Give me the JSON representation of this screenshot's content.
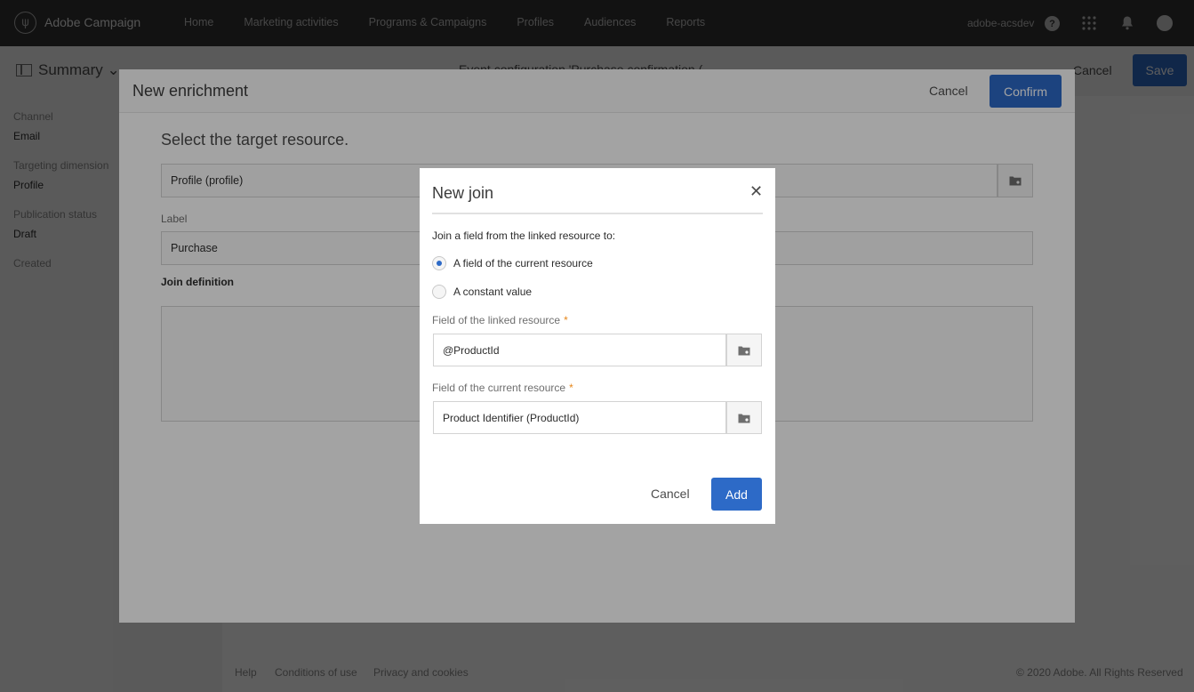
{
  "app": {
    "brand": "Adobe Campaign"
  },
  "nav": {
    "links": [
      "Home",
      "Marketing activities",
      "Programs & Campaigns",
      "Profiles",
      "Audiences",
      "Reports"
    ],
    "account": "adobe-acsdev",
    "help_glyph": "?"
  },
  "page": {
    "summary_label": "Summary",
    "summary_chevron": "⌄",
    "title": "Event configuration 'Purchase confirmation (",
    "cancel_label": "Cancel",
    "save_label": "Save",
    "side": [
      {
        "label": "Channel",
        "value": "Email"
      },
      {
        "label": "Targeting dimension",
        "value": "Profile"
      },
      {
        "label": "Publication status",
        "value": "Draft"
      },
      {
        "label": "Created",
        "value": ""
      }
    ],
    "footer": {
      "links": [
        "Help",
        "Conditions of use",
        "Privacy and cookies"
      ],
      "copyright": "© 2020 Adobe. All Rights Reserved"
    }
  },
  "enrichment": {
    "title": "New enrichment",
    "cancel_label": "Cancel",
    "confirm_label": "Confirm",
    "heading": "Select the target resource.",
    "target_value": "Profile (profile)",
    "label_caption": "Label",
    "label_value": "Purchase",
    "join_definition": "Join definition"
  },
  "join_modal": {
    "title": "New join",
    "close_glyph": "✕",
    "intro": "Join a field from the linked resource to:",
    "options": [
      {
        "label": "A field of the current resource",
        "selected": true
      },
      {
        "label": "A constant value",
        "selected": false
      }
    ],
    "linked_field": {
      "label": "Field of the linked resource",
      "required_mark": "*",
      "value": "@ProductId"
    },
    "current_field": {
      "label": "Field of the current resource",
      "required_mark": "*",
      "value": "Product Identifier (ProductId)"
    },
    "cancel_label": "Cancel",
    "add_label": "Add"
  },
  "colors": {
    "accent": "#2d6ac7",
    "topbar": "#323232",
    "required": "#e68619"
  },
  "icons": [
    "campaign-logo-icon",
    "help-icon",
    "apps-grid-icon",
    "notification-bell-icon",
    "summary-panel-icon",
    "resource-picker-icon",
    "close-icon"
  ]
}
